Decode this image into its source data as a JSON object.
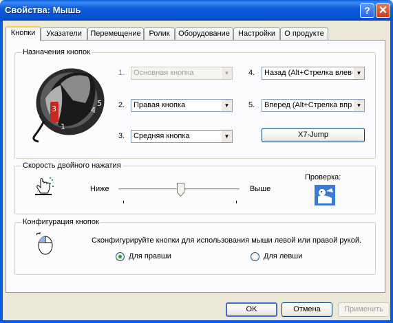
{
  "window": {
    "title": "Свойства: Мышь",
    "help_glyph": "?",
    "close_glyph": "✕"
  },
  "tabs": [
    {
      "label": "Кнопки",
      "active": true
    },
    {
      "label": "Указатели"
    },
    {
      "label": "Перемещение"
    },
    {
      "label": "Ролик"
    },
    {
      "label": "Оборудование"
    },
    {
      "label": "Настройки"
    },
    {
      "label": "О продукте"
    }
  ],
  "buttons_group": {
    "label": "Назначения кнопок",
    "mouse_image_labels": [
      "1",
      "2",
      "3",
      "4",
      "5"
    ],
    "assignments": [
      {
        "num": "1.",
        "value": "Основная кнопка",
        "disabled": true
      },
      {
        "num": "2.",
        "value": "Правая кнопка"
      },
      {
        "num": "3.",
        "value": "Средняя кнопка"
      },
      {
        "num": "4.",
        "value": "Назад (Alt+Стрелка влево)"
      },
      {
        "num": "5.",
        "value": "Вперед (Alt+Стрелка вправо)"
      }
    ],
    "x7_button": "X7-Jump"
  },
  "dblclick_group": {
    "label": "Скорость двойного нажатия",
    "slow_label": "Ниже",
    "fast_label": "Выше",
    "test_label": "Проверка:",
    "speed_level": 0.5
  },
  "config_group": {
    "label": "Конфигурация кнопок",
    "description": "Сконфигурируйте кнопки для использования мыши левой или правой рукой.",
    "options": [
      {
        "label": "Для правши",
        "selected": true
      },
      {
        "label": "Для левши",
        "selected": false
      }
    ]
  },
  "footer": {
    "ok": "OK",
    "cancel": "Отмена",
    "apply": "Применить"
  },
  "colors": {
    "titlebar": "#0553D0",
    "dialog_bg": "#ECE9D8",
    "tab_active_accent": "#FFC83C"
  },
  "icons": {
    "pointer_preview": "hand-pointer-icon",
    "test_area": "jack-in-box-icon",
    "handedness": "mouse-icon"
  }
}
